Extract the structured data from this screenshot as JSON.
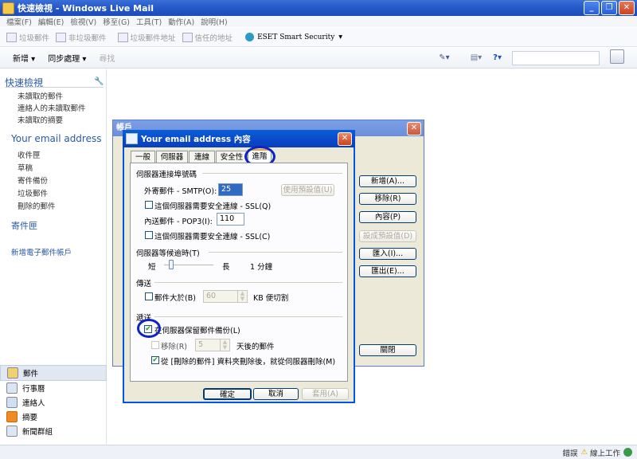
{
  "window": {
    "title": "快速檢視 - Windows Live Mail",
    "min": "_",
    "max": "❐",
    "close": "✕"
  },
  "menu": [
    "檔案(F)",
    "編輯(E)",
    "檢視(V)",
    "移至(G)",
    "工具(T)",
    "動作(A)",
    "說明(H)"
  ],
  "toolbar1": {
    "items": [
      "垃圾郵件",
      "非垃圾郵件",
      "垃圾郵件地址",
      "信任的地址"
    ],
    "eset": "ESET Smart Security",
    "eset_arrow": "▾"
  },
  "toolbar2": {
    "new": "新增 ▾",
    "sync": "同步處理 ▾",
    "find": "尋找"
  },
  "nav": {
    "quick_views": "快速檢視",
    "quick_items": [
      "未讀取的郵件",
      "連絡人的未讀取郵件",
      "未讀取的摘要"
    ],
    "account": "Your email address",
    "account_items": [
      "收件匣",
      "草稿",
      "寄件備份",
      "垃圾郵件",
      "刪除的郵件"
    ],
    "outbox": "寄件匣",
    "add_account": "新增電子郵件帳戶"
  },
  "modules": [
    "郵件",
    "行事曆",
    "連絡人",
    "摘要",
    "新聞群組"
  ],
  "status": {
    "error": "錯誤",
    "online": "線上工作"
  },
  "back_dialog": {
    "title": "帳戶",
    "buttons": [
      "新增(A)...",
      "移除(R)",
      "內容(P)",
      "設成預設值(D)",
      "匯入(I)...",
      "匯出(E)..."
    ],
    "close": "關閉"
  },
  "dialog": {
    "title": "Your email address 內容",
    "tabs": [
      "一般",
      "伺服器",
      "連線",
      "安全性",
      "進階"
    ],
    "ports_group": "伺服器連接埠號碼",
    "smtp_label": "外寄郵件 - SMTP(O):",
    "smtp_value": "25",
    "use_defaults": "使用預設值(U)",
    "smtp_ssl": "這個伺服器需要安全連線 - SSL(Q)",
    "pop3_label": "內送郵件 - POP3(I):",
    "pop3_value": "110",
    "pop3_ssl": "這個伺服器需要安全連線 - SSL(C)",
    "timeout_group": "伺服器等候逾時(T)",
    "short": "短",
    "long": "長",
    "timeout_value": "1 分鐘",
    "timeout_level": 0.1,
    "sending_group": "傳送",
    "split_label": "郵件大於(B)",
    "split_value": "60",
    "split_suffix": "KB 便切割",
    "delivery_group": "遞送",
    "leave_copy": "在伺服器保留郵件備份(L)",
    "remove_label": "移除(R)",
    "remove_value": "5",
    "remove_suffix": "天後的郵件",
    "remove_deleted": "從 [刪除的郵件] 資料夾刪除後，就從伺服器刪除(M)",
    "ok": "確定",
    "cancel": "取消",
    "apply": "套用(A)"
  },
  "colors": {
    "highlight_circle": "#0d22c8",
    "titlebar": "#0a47c9"
  }
}
